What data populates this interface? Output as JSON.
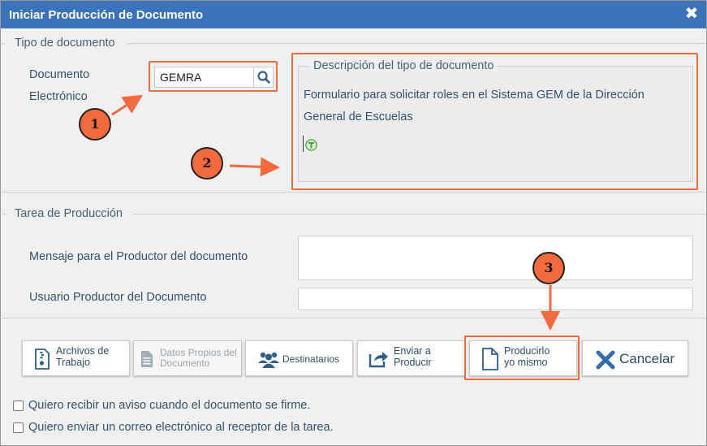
{
  "dialog": {
    "title": "Iniciar Producción de Documento",
    "close_icon": "close-icon"
  },
  "tipo_documento": {
    "section_label": "Tipo de documento",
    "documento_label_1": "Documento",
    "documento_label_2": "Electrónico",
    "documento_value": "GEMRA",
    "search_icon": "search-icon",
    "descripcion_legend": "Descripción del tipo de documento",
    "descripcion_line_1": "Formulario para solicitar roles en el Sistema GEM de la Dirección",
    "descripcion_line_2": "General de Escuelas",
    "type_icon": "template-t-icon"
  },
  "tarea_produccion": {
    "section_label": "Tarea de Producción",
    "mensaje_label": "Mensaje para el Productor del documento",
    "mensaje_value": "",
    "usuario_label": "Usuario Productor del Documento",
    "usuario_value": ""
  },
  "buttons": {
    "archivos_line_1": "Archivos de",
    "archivos_line_2": "Trabajo",
    "datos_line_1": "Datos Propios del",
    "datos_line_2": "Documento",
    "destinatarios": "Destinatarios",
    "enviar_line_1": "Enviar a",
    "enviar_line_2": "Producir",
    "producir_line_1": "Producirlo",
    "producir_line_2": "yo mismo",
    "cancelar": "Cancelar"
  },
  "checkboxes": {
    "aviso_firma": "Quiero recibir un aviso cuando el documento se firme.",
    "correo_receptor": "Quiero enviar un correo electrónico al receptor de la tarea."
  },
  "annotations": {
    "badge_1": "1",
    "badge_2": "2",
    "badge_3": "3"
  },
  "colors": {
    "titlebar": "#3a73b9",
    "highlight": "#f26a3d",
    "text": "#34526e",
    "cancel_icon": "#2f6fae"
  }
}
